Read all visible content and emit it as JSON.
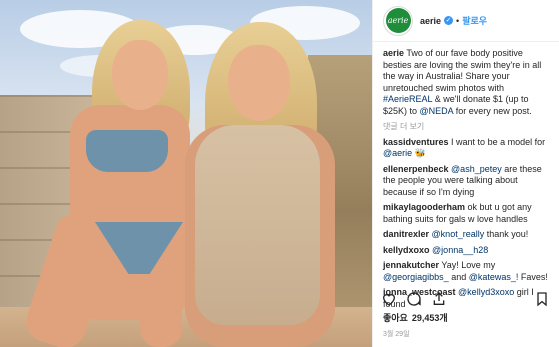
{
  "header": {
    "avatar_text": "aerie",
    "username": "aerie",
    "separator": "•",
    "follow_label": "팔로우"
  },
  "caption": {
    "username": "aerie",
    "text_1": " Two of our fave body positive besties are loving the swim they're in all the way in Australia! Share your unretouched swim photos with ",
    "hashtag": "#AerieREAL",
    "text_2": " & we'll donate $1 (up to $25K) to ",
    "mention": "@NEDA",
    "text_3": " for every new post."
  },
  "view_replies": "댓글 더 보기",
  "comments": [
    {
      "user": "kassidventures",
      "pre": " I want to be a model for ",
      "mention": "@aerie",
      "post": " 🐝"
    },
    {
      "user": "ellenerpenbeck",
      "pre": " ",
      "mention": "@ash_petey",
      "post": " are these the people you were talking about because if so I'm dying"
    },
    {
      "user": "mikaylagooderham",
      "pre": " ok but u got any bathing suits for gals w love handles",
      "mention": "",
      "post": ""
    },
    {
      "user": "danitrexler",
      "pre": " ",
      "mention": "@knot_really",
      "post": " thank you!"
    },
    {
      "user": "kellydxoxo",
      "pre": " ",
      "mention": "@jonna__h28",
      "post": ""
    },
    {
      "user": "jennakutcher",
      "pre": " Yay! Love my ",
      "mention": "@georgiagibbs_",
      "post": " and ",
      "mention2": "@katewas_!",
      "post2": " Faves!"
    },
    {
      "user": "ionna_westcoast",
      "pre": " ",
      "mention": "@kellyd3xoxo",
      "post": " girl I found"
    }
  ],
  "likes": {
    "label": "좋아요",
    "count": "29,453개"
  },
  "date": "3월 29일",
  "icons": [
    "heart-icon",
    "comment-icon",
    "share-icon",
    "bookmark-icon"
  ],
  "colors": {
    "link": "#003569",
    "follow": "#3897f0",
    "brand": "#1f8e3b"
  }
}
